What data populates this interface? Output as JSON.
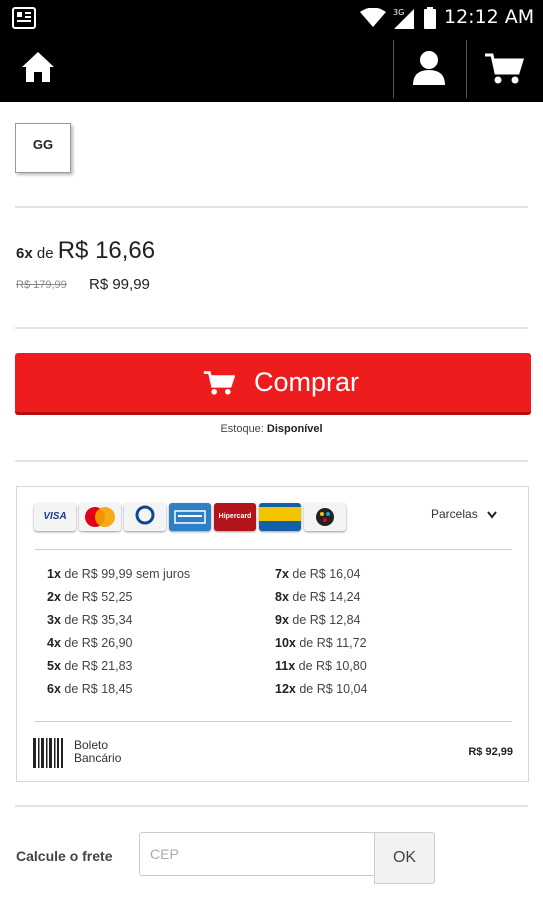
{
  "status_bar": {
    "time": "12:12 AM",
    "network": "3G"
  },
  "nav": {
    "home_icon": "home-icon",
    "user_icon": "user-icon",
    "cart_icon": "cart-icon"
  },
  "product": {
    "selected_size": "GG",
    "installments_count": "6x",
    "installments_connector": "de",
    "installment_amount": "R$ 16,66",
    "old_price": "R$ 179,99",
    "price": "R$ 99,99"
  },
  "buy": {
    "label": "Comprar",
    "icon": "cart-icon",
    "color": "#ee1c1c"
  },
  "stock": {
    "label": "Estoque:",
    "value": "Disponível"
  },
  "payment": {
    "cards": [
      "VISA",
      "MasterCard",
      "Diners Club",
      "American Express",
      "Hipercard",
      "Aura",
      "Elo"
    ],
    "dropdown_label": "Parcelas",
    "installments_left": [
      {
        "n": "1x",
        "text": "de R$ 99,99 sem juros"
      },
      {
        "n": "2x",
        "text": "de R$ 52,25"
      },
      {
        "n": "3x",
        "text": "de R$ 35,34"
      },
      {
        "n": "4x",
        "text": "de R$ 26,90"
      },
      {
        "n": "5x",
        "text": "de R$ 21,83"
      },
      {
        "n": "6x",
        "text": "de R$ 18,45"
      }
    ],
    "installments_right": [
      {
        "n": "7x",
        "text": "de R$ 16,04"
      },
      {
        "n": "8x",
        "text": "de R$ 14,24"
      },
      {
        "n": "9x",
        "text": "de R$ 12,84"
      },
      {
        "n": "10x",
        "text": "de R$ 11,72"
      },
      {
        "n": "11x",
        "text": "de R$ 10,80"
      },
      {
        "n": "12x",
        "text": "de R$ 10,04"
      }
    ],
    "boleto_line1": "Boleto",
    "boleto_line2": "Bancário",
    "boleto_price": "R$ 92,99"
  },
  "freight": {
    "label": "Calcule o frete",
    "placeholder": "CEP",
    "button": "OK"
  }
}
